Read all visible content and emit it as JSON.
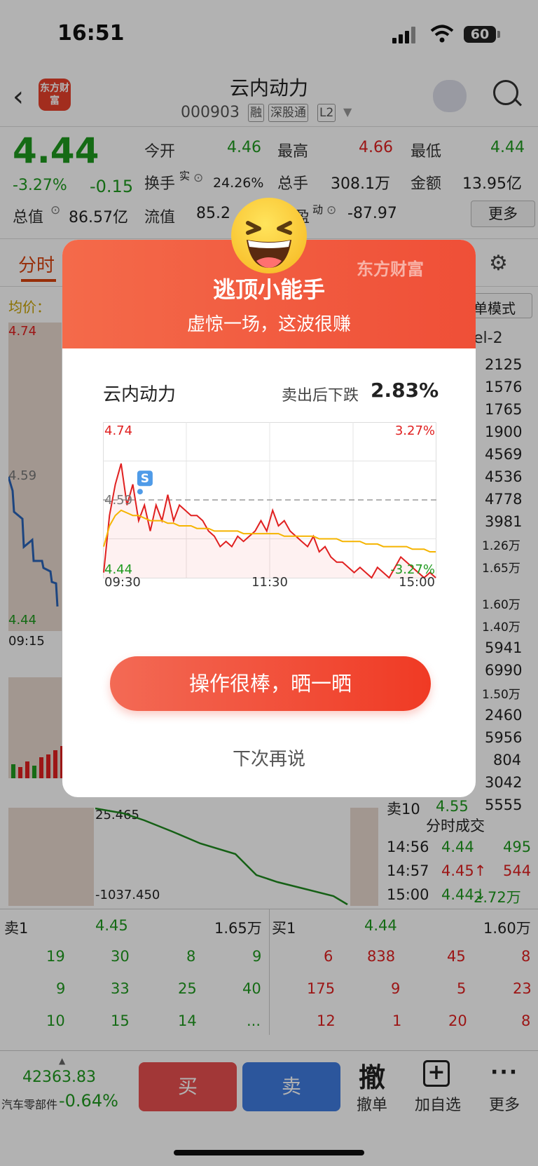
{
  "status": {
    "time": "16:51",
    "battery": "60"
  },
  "header": {
    "logo_text": "东方财富",
    "name": "云内动力",
    "code": "000903",
    "tags": [
      "融",
      "深股通",
      "L2"
    ]
  },
  "quote": {
    "price": "4.44",
    "change_pct": "-3.27%",
    "change": "-0.15",
    "stats": {
      "open_label": "今开",
      "open": "4.46",
      "high_label": "最高",
      "high": "4.66",
      "low_label": "最低",
      "low": "4.44",
      "turnover_label": "换手",
      "turnover_sup": "实",
      "turnover": "24.26%",
      "volume_label": "总手",
      "volume": "308.1万",
      "amount_label": "金额",
      "amount": "13.95亿",
      "mktcap_label": "总值",
      "mktcap": "86.57亿",
      "float_label": "流值",
      "float": "85.2",
      "pe_label": "盈",
      "pe_sup": "动",
      "pe": "-87.97",
      "more": "更多"
    }
  },
  "tabs": {
    "fenshi": "分时",
    "avg_label": "均价：",
    "mode": "单模式",
    "level2": "el-2"
  },
  "bg_chart": {
    "top": "4.74",
    "mid": "4.59",
    "bottom": "4.44",
    "time": "09:15",
    "ind_top": "25.465",
    "ind_bottom": "-1037.450"
  },
  "right_volumes": [
    {
      "v": "2125"
    },
    {
      "v": "1576"
    },
    {
      "v": "1765"
    },
    {
      "v": "1900"
    },
    {
      "v": "4569"
    },
    {
      "v": "4536"
    },
    {
      "v": "4778"
    },
    {
      "v": "3981"
    },
    {
      "v": "1.26万"
    },
    {
      "v": "1.65万"
    },
    {
      "v": "1.60万"
    },
    {
      "v": "1.40万"
    },
    {
      "v": "5941"
    },
    {
      "v": "6990"
    },
    {
      "v": "1.50万"
    },
    {
      "v": "2460"
    },
    {
      "v": "5956"
    },
    {
      "v": "804"
    },
    {
      "v": "3042"
    },
    {
      "v": "5555"
    }
  ],
  "sell10": {
    "label": "卖10",
    "price": "4.55"
  },
  "ticks": {
    "title": "分时成交",
    "rows": [
      {
        "time": "14:56",
        "price": "4.44",
        "vol": "495"
      },
      {
        "time": "14:57",
        "price": "4.45↑",
        "vol": "544"
      },
      {
        "time": "15:00",
        "price": "4.44↓",
        "vol": "2.72万"
      }
    ]
  },
  "orderbook": {
    "sell1_label": "卖1",
    "sell1_price": "4.45",
    "sell1_vol": "1.65万",
    "buy1_label": "买1",
    "buy1_price": "4.44",
    "buy1_vol": "1.60万",
    "sell_rows": [
      [
        "19",
        "30",
        "8",
        "9"
      ],
      [
        "9",
        "33",
        "25",
        "40"
      ],
      [
        "10",
        "15",
        "14",
        "..."
      ]
    ],
    "buy_rows": [
      [
        "6",
        "838",
        "45",
        "8"
      ],
      [
        "175",
        "9",
        "5",
        "23"
      ],
      [
        "12",
        "1",
        "20",
        "8"
      ]
    ]
  },
  "bottom": {
    "index_value": "42363.83",
    "index_name": "汽车零部件",
    "index_change": "-0.64%",
    "buy": "买",
    "sell": "卖",
    "cancel_icon": "撤",
    "cancel": "撤单",
    "watch": "加自选",
    "more": "更多"
  },
  "modal": {
    "brand": "东方财富",
    "title": "逃顶小能手",
    "subtitle": "虚惊一场，这波很赚",
    "stock": "云内动力",
    "drop_label": "卖出后下跌",
    "drop_value": "2.83%",
    "cta": "操作很棒，晒一晒",
    "later": "下次再说"
  },
  "chart_data": {
    "type": "line",
    "y_top_label": "4.74",
    "y_mid_label": "4.59",
    "y_bottom_label": "4.44",
    "pct_top_label": "3.27%",
    "pct_bottom_label": "-3.27%",
    "x_labels": [
      "09:30",
      "11:30",
      "15:00"
    ],
    "ylim": [
      4.44,
      4.74
    ],
    "prev_close": 4.59,
    "marker": "S",
    "series": [
      {
        "values": [
          4.45,
          4.56,
          4.62,
          4.66,
          4.58,
          4.62,
          4.55,
          4.58,
          4.53,
          4.58,
          4.55,
          4.6,
          4.55,
          4.58,
          4.57,
          4.56,
          4.56,
          4.55,
          4.53,
          4.52,
          4.5,
          4.51,
          4.5,
          4.52,
          4.51,
          4.52,
          4.53,
          4.55,
          4.53,
          4.57,
          4.54,
          4.55,
          4.53,
          4.52,
          4.51,
          4.5,
          4.52,
          4.49,
          4.5,
          4.48,
          4.47,
          4.47,
          4.46,
          4.45,
          4.46,
          4.45,
          4.44,
          4.46,
          4.45,
          4.44,
          4.46,
          4.48,
          4.47,
          4.46,
          4.45,
          4.44,
          4.45,
          4.44
        ]
      },
      {
        "values": [
          4.5,
          4.54,
          4.56,
          4.57,
          4.565,
          4.56,
          4.56,
          4.555,
          4.55,
          4.55,
          4.55,
          4.545,
          4.545,
          4.54,
          4.54,
          4.54,
          4.535,
          4.535,
          4.535,
          4.53,
          4.53,
          4.53,
          4.53,
          4.53,
          4.525,
          4.525,
          4.525,
          4.525,
          4.525,
          4.525,
          4.525,
          4.52,
          4.52,
          4.52,
          4.52,
          4.52,
          4.52,
          4.515,
          4.515,
          4.515,
          4.515,
          4.51,
          4.51,
          4.51,
          4.51,
          4.505,
          4.505,
          4.505,
          4.5,
          4.5,
          4.5,
          4.5,
          4.5,
          4.495,
          4.495,
          4.495,
          4.49,
          4.49
        ]
      }
    ]
  }
}
